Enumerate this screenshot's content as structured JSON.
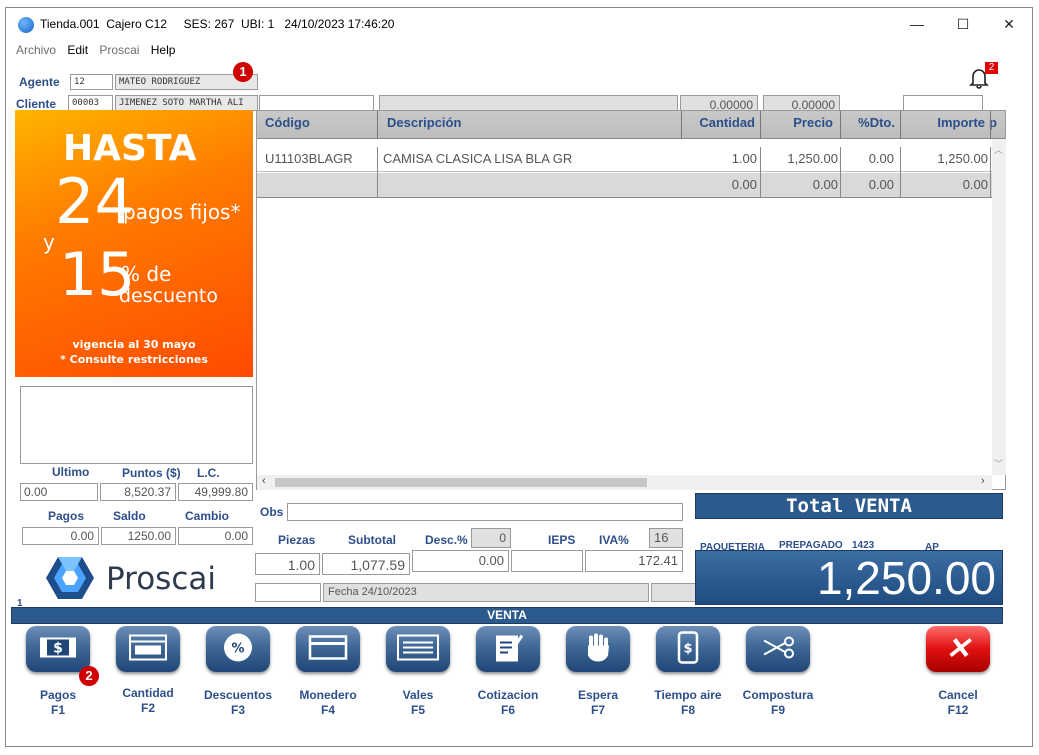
{
  "window": {
    "title": "Tienda.001  Cajero C12     SES: 267  UBI: 1   24/10/2023 17:46:20",
    "minimize": "—",
    "maximize": "☐",
    "close": "✕"
  },
  "menu": [
    {
      "label": "Archivo",
      "dim": true
    },
    {
      "label": "Edit",
      "dim": false
    },
    {
      "label": "Proscai",
      "dim": true
    },
    {
      "label": "Help",
      "dim": false
    }
  ],
  "agente": {
    "label": "Agente",
    "code": "12",
    "name": "MATEO RODRIGUEZ"
  },
  "cliente": {
    "label": "Cliente",
    "code": "00003",
    "name": "JIMENEZ SOTO MARTHA ALI"
  },
  "badges": {
    "one": "1",
    "two": "2"
  },
  "notification": {
    "count": "2"
  },
  "top_fields": {
    "v1": "0.00000",
    "v2": "0.00000"
  },
  "promo": {
    "hasta": "HASTA",
    "num24": "24",
    "pagos_fijos": "pagos fijos*",
    "y": "y",
    "num15": "15",
    "pct_de": "% de",
    "descuento": "descuento",
    "vigencia": "vigencia al 30 mayo",
    "restricciones": "* Consulte restricciones"
  },
  "table": {
    "headers": [
      "Código",
      "Descripción",
      "Cantidad",
      "Precio",
      "%Dto.",
      "Importe",
      "p"
    ],
    "rows": [
      [
        "U11103BLAGR",
        "CAMISA CLASICA LISA BLA GR",
        "1.00",
        "1,250.00",
        "0.00",
        "1,250.00"
      ],
      [
        "",
        "",
        "0.00",
        "0.00",
        "0.00",
        "0.00"
      ]
    ]
  },
  "customer_stats": {
    "headers": [
      "Ultimo",
      "Puntos ($)",
      "L.C."
    ],
    "values": [
      "0.00",
      "8,520.37",
      "49,999.80"
    ]
  },
  "payments": {
    "headers": [
      "Pagos",
      "Saldo",
      "Cambio"
    ],
    "values": [
      "0.00",
      "1250.00",
      "0.00"
    ]
  },
  "obs_label": "Obs",
  "totals_row": {
    "headers": [
      "Piezas",
      "Subtotal",
      "Desc.%",
      "IEPS",
      "IVA%"
    ],
    "desc_pct": "0",
    "iva_pct": "16",
    "values": [
      "1.00",
      "1,077.59",
      "0.00",
      "",
      "172.41"
    ]
  },
  "fecha": "Fecha 24/10/2023",
  "logo_text": "Proscai",
  "counter": "1",
  "total_venta": {
    "label": "Total VENTA",
    "amount": "1,250.00"
  },
  "paqueteria": {
    "paqueteria": "PAQUETERIA",
    "prepagado": "PREPAGADO",
    "num": "1423",
    "ap": "AP"
  },
  "venta_bar": "VENTA",
  "fkeys": [
    {
      "label": "Pagos",
      "key": "F1",
      "icon": "cash-icon"
    },
    {
      "label": "Cantidad",
      "key": "F2",
      "icon": "calculator-icon"
    },
    {
      "label": "Descuentos",
      "key": "F3",
      "icon": "percent-icon"
    },
    {
      "label": "Monedero",
      "key": "F4",
      "icon": "wallet-card-icon"
    },
    {
      "label": "Vales",
      "key": "F5",
      "icon": "voucher-icon"
    },
    {
      "label": "Cotizacion",
      "key": "F6",
      "icon": "quote-icon"
    },
    {
      "label": "Espera",
      "key": "F7",
      "icon": "hand-icon"
    },
    {
      "label": "Tiempo aire",
      "key": "F8",
      "icon": "phone-icon"
    },
    {
      "label": "Compostura",
      "key": "F9",
      "icon": "scissors-icon"
    },
    {
      "label": "Cancel",
      "key": "F12",
      "icon": "cancel-icon"
    }
  ]
}
